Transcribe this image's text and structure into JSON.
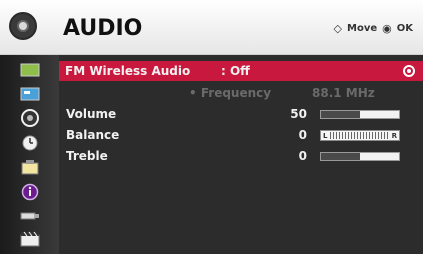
{
  "header": {
    "title": "AUDIO",
    "move_label": "Move",
    "ok_label": "OK",
    "move_symbol": "◇",
    "ok_symbol": "◉"
  },
  "sidebar": {
    "items": [
      {
        "name": "picture-icon"
      },
      {
        "name": "screen-icon"
      },
      {
        "name": "audio-icon"
      },
      {
        "name": "time-icon"
      },
      {
        "name": "option-icon"
      },
      {
        "name": "information-icon"
      },
      {
        "name": "input-icon"
      },
      {
        "name": "media-icon"
      }
    ],
    "active_index": 5
  },
  "menu": {
    "fm_wireless": {
      "label": "FM Wireless Audio",
      "value": ": Off"
    },
    "frequency": {
      "label": "• Frequency",
      "value": "88.1 MHz"
    },
    "volume": {
      "label": "Volume",
      "value": "50",
      "level": 0.5
    },
    "balance": {
      "label": "Balance",
      "value": "0",
      "left_letter": "L",
      "right_letter": "R"
    },
    "treble": {
      "label": "Treble",
      "value": "0",
      "level": 0.5
    }
  },
  "colors": {
    "selected": "#c9183e",
    "panel": "#2c2c2c",
    "sidebar": "#1b1b1b"
  }
}
